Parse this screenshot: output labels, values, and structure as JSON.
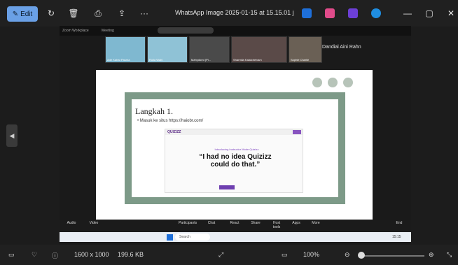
{
  "titlebar": {
    "edit_label": "Edit",
    "title": "WhatsApp Image 2025-01-15 at 15.15.01 j...",
    "more": "···",
    "minimize": "—",
    "maximize": "▢",
    "close": "✕"
  },
  "zoom_top": {
    "app": "Zoom Workplace",
    "tab": "Meeting"
  },
  "participants": [
    {
      "cap": "Ade Kahar Pasma"
    },
    {
      "cap": "Rulia Wahi"
    },
    {
      "cap": "Mahydorni (Pi..."
    },
    {
      "cap": "Sharmila Kalaichelvam"
    },
    {
      "cap": "Sophie Charlie"
    }
  ],
  "presenter": "Dandial Aini Rahn",
  "slide": {
    "heading": "Langkah 1.",
    "bullet": "•  Masuk ke situs https://haiobr.com/",
    "shot_logo": "QUIZIZZ",
    "shot_small": "Introducing Instructor Mode Quizizz",
    "shot_heading": "“I had no idea Quizizz could do that.”"
  },
  "zoom_controls": [
    "Audio",
    "Video",
    "Participants",
    "Chat",
    "React",
    "Share",
    "Host tools",
    "Apps",
    "More",
    "End"
  ],
  "taskbar": {
    "search": "Search",
    "time": "15:15"
  },
  "statusbar": {
    "info": "Info",
    "dimensions": "1600 x 1000",
    "size": "199.6 KB",
    "zoom": "100%"
  }
}
